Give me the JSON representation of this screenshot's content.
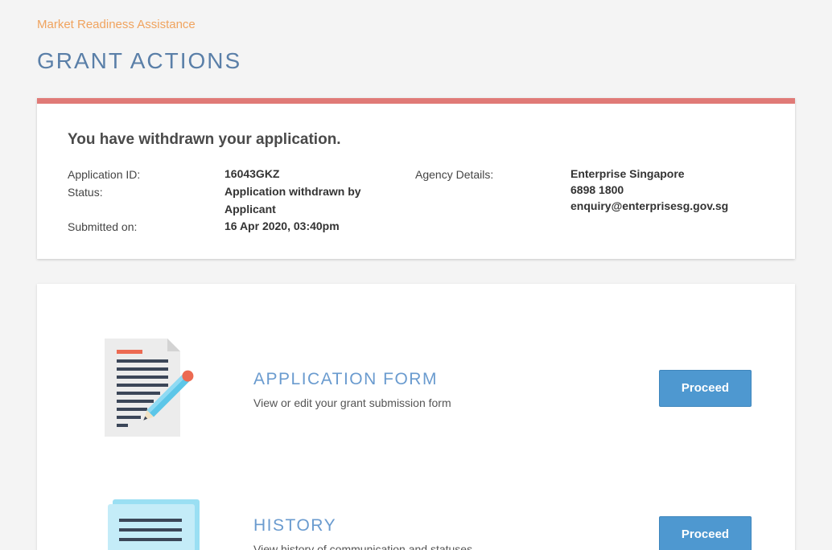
{
  "breadcrumb": "Market Readiness Assistance",
  "page_title": "GRANT ACTIONS",
  "colors": {
    "status_bar": "#e07a77",
    "accent": "#4e98d0",
    "breadcrumb": "#f0a35e",
    "title": "#5a7fa8"
  },
  "status": {
    "heading": "You have withdrawn your application.",
    "application_id_label": "Application ID:",
    "application_id_value": "16043GKZ",
    "status_label": "Status:",
    "status_value_line1": "Application withdrawn by",
    "status_value_line2": "Applicant",
    "submitted_label": "Submitted on:",
    "submitted_value": "16 Apr 2020, 03:40pm",
    "agency_label": "Agency Details:",
    "agency_name": "Enterprise Singapore",
    "agency_phone": "6898 1800",
    "agency_email": "enquiry@enterprisesg.gov.sg"
  },
  "actions": [
    {
      "icon": "document-edit-icon",
      "title": "APPLICATION FORM",
      "description": "View or edit your grant submission form",
      "button_label": "Proceed"
    },
    {
      "icon": "history-document-icon",
      "title": "HISTORY",
      "description": "View history of communication and statuses",
      "button_label": "Proceed"
    }
  ]
}
